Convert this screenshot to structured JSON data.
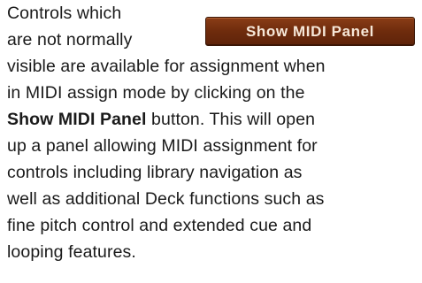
{
  "button": {
    "label": "Show MIDI Panel"
  },
  "paragraph": {
    "lines": [
      "Controls which",
      "are not normally",
      "visible are available for assignment when",
      "in MIDI assign mode by clicking on the",
      "Show MIDI Panel",
      " button. This will open",
      "up a panel allowing MIDI assignment for",
      "controls including library navigation as",
      "well as additional Deck functions such as",
      "fine pitch control and extended cue and",
      "looping features."
    ]
  },
  "colors": {
    "button_background": "#6f2c0d",
    "button_text": "#f6e7d8",
    "body_text": "#1a1a1a"
  }
}
